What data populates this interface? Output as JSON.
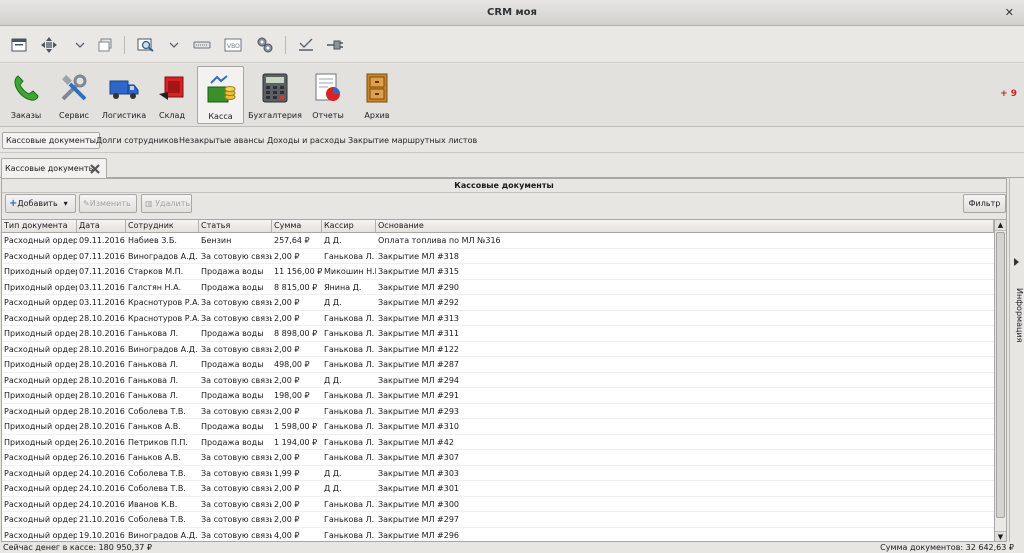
{
  "window": {
    "title": "CRM моя"
  },
  "toolbar_icons": [
    "window-icon",
    "move-icon",
    "restore-icon",
    "search-preview-icon",
    "dropdown-chevron-icon",
    "keyboard-icon",
    "vbox-icon",
    "settings-group-icon",
    "check-icon",
    "plug-icon"
  ],
  "modules": [
    {
      "label": "Заказы",
      "icon": "phone-icon",
      "active": false
    },
    {
      "label": "Сервис",
      "icon": "tools-icon",
      "active": false
    },
    {
      "label": "Логистика",
      "icon": "truck-icon",
      "active": false
    },
    {
      "label": "Склад",
      "icon": "warehouse-icon",
      "active": false
    },
    {
      "label": "Касса",
      "icon": "cash-register-icon",
      "active": true
    },
    {
      "label": "Бухгалтерия",
      "icon": "calculator-icon",
      "active": false
    },
    {
      "label": "Отчеты",
      "icon": "report-chart-icon",
      "active": false
    },
    {
      "label": "Архив",
      "icon": "archive-cabinet-icon",
      "active": false
    }
  ],
  "counter": "+ 9",
  "subtabs": [
    "Кассовые документы",
    "Долги сотрудников",
    "Незакрытые авансы",
    "Доходы и расходы",
    "Закрытие маршрутных листов"
  ],
  "doc_tab": {
    "label": "Кассовые документы"
  },
  "panel": {
    "title": "Кассовые документы",
    "add_label": "Добавить",
    "edit_label": "Изменить",
    "delete_label": "Удалить",
    "filter_label": "Фильтр"
  },
  "table": {
    "columns": [
      "Тип документа",
      "Дата",
      "Сотрудник",
      "Статья",
      "Сумма",
      "Кассир",
      "Основание"
    ],
    "rows": [
      [
        "Расходный ордер",
        "09.11.2016",
        "Набиев З.Б.",
        "Бензин",
        "257,64 ₽",
        "Д Д.",
        "Оплата топлива по МЛ №316"
      ],
      [
        "Расходный ордер",
        "07.11.2016",
        "Виноградов А.Д.",
        "За сотовую связь",
        "2,00 ₽",
        "Ганькова Л.",
        "Закрытие МЛ #318"
      ],
      [
        "Приходный ордер",
        "07.11.2016",
        "Старков М.П.",
        "Продажа воды",
        "11 156,00 ₽",
        "Микошин Н.В.",
        "Закрытие МЛ #315"
      ],
      [
        "Приходный ордер",
        "03.11.2016",
        "Галстян Н.А.",
        "Продажа воды",
        "8 815,00 ₽",
        "Янина Д.",
        "Закрытие МЛ #290"
      ],
      [
        "Расходный ордер",
        "03.11.2016",
        "Краснотуров Р.А.",
        "За сотовую связь",
        "2,00 ₽",
        "Д Д.",
        "Закрытие МЛ #292"
      ],
      [
        "Расходный ордер",
        "28.10.2016",
        "Краснотуров Р.А.",
        "За сотовую связь",
        "2,00 ₽",
        "Ганькова Л.",
        "Закрытие МЛ #313"
      ],
      [
        "Приходный ордер",
        "28.10.2016",
        "Ганькова Л.",
        "Продажа воды",
        "8 898,00 ₽",
        "Ганькова Л.",
        "Закрытие МЛ #311"
      ],
      [
        "Расходный ордер",
        "28.10.2016",
        "Виноградов А.Д.",
        "За сотовую связь",
        "2,00 ₽",
        "Ганькова Л.",
        "Закрытие МЛ #122"
      ],
      [
        "Приходный ордер",
        "28.10.2016",
        "Ганькова Л.",
        "Продажа воды",
        "498,00 ₽",
        "Ганькова Л.",
        "Закрытие МЛ #287"
      ],
      [
        "Расходный ордер",
        "28.10.2016",
        "Ганькова Л.",
        "За сотовую связь",
        "2,00 ₽",
        "Д Д.",
        "Закрытие МЛ #294"
      ],
      [
        "Приходный ордер",
        "28.10.2016",
        "Ганькова Л.",
        "Продажа воды",
        "198,00 ₽",
        "Ганькова Л.",
        "Закрытие МЛ #291"
      ],
      [
        "Расходный ордер",
        "28.10.2016",
        "Соболева Т.В.",
        "За сотовую связь",
        "2,00 ₽",
        "Ганькова Л.",
        "Закрытие МЛ #293"
      ],
      [
        "Приходный ордер",
        "28.10.2016",
        "Ганьков А.В.",
        "Продажа воды",
        "1 598,00 ₽",
        "Ганькова Л.",
        "Закрытие МЛ #310"
      ],
      [
        "Приходный ордер",
        "26.10.2016",
        "Петриков П.П.",
        "Продажа воды",
        "1 194,00 ₽",
        "Ганькова Л.",
        "Закрытие МЛ #42"
      ],
      [
        "Расходный ордер",
        "26.10.2016",
        "Ганьков А.В.",
        "За сотовую связь",
        "2,00 ₽",
        "Ганькова Л.",
        "Закрытие МЛ #307"
      ],
      [
        "Расходный ордер",
        "24.10.2016",
        "Соболева Т.В.",
        "За сотовую связь",
        "1,99 ₽",
        "Д Д.",
        "Закрытие МЛ #303"
      ],
      [
        "Расходный ордер",
        "24.10.2016",
        "Соболева Т.В.",
        "За сотовую связь",
        "2,00 ₽",
        "Д Д.",
        "Закрытие МЛ #301"
      ],
      [
        "Расходный ордер",
        "24.10.2016",
        "Иванов К.В.",
        "За сотовую связь",
        "2,00 ₽",
        "Ганькова Л.",
        "Закрытие МЛ #300"
      ],
      [
        "Расходный ордер",
        "21.10.2016",
        "Соболева Т.В.",
        "За сотовую связь",
        "2,00 ₽",
        "Ганькова Л.",
        "Закрытие МЛ #297"
      ],
      [
        "Расходный ордер",
        "19.10.2016",
        "Виноградов А.Д.",
        "За сотовую связь",
        "4,00 ₽",
        "Ганькова Л.",
        "Закрытие МЛ #296"
      ]
    ]
  },
  "sidebar": {
    "label": "Информация"
  },
  "status": {
    "left": "Сейчас денег в кассе: 180 950,37 ₽",
    "right": "Сумма документов: 32 642,63 ₽"
  },
  "colors": {
    "counter": "#cc1f1f",
    "background": "#e8e6e3"
  }
}
